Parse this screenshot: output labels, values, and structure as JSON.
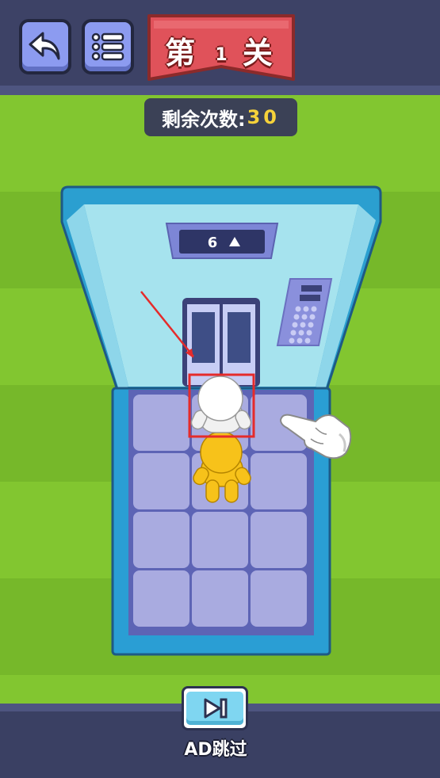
{
  "header": {
    "level_prefix": "第",
    "level_number": "1",
    "level_suffix": "关"
  },
  "moves": {
    "label": "剩余次数:",
    "value": "30"
  },
  "elevator": {
    "floor_display": "6",
    "direction": "up",
    "grid_rows": 4,
    "grid_cols": 3
  },
  "characters": [
    {
      "name": "white",
      "color": "#ffffff",
      "row": 0,
      "col": 1,
      "highlighted": true
    },
    {
      "name": "yellow",
      "color": "#f7c21a",
      "row": 1,
      "col": 1,
      "highlighted": false
    }
  ],
  "footer": {
    "skip_label": "AD跳过"
  },
  "icons": {
    "back": "undo-arrow-icon",
    "menu": "list-menu-icon",
    "skip": "skip-next-icon",
    "hint": "pointing-hand-icon"
  },
  "colors": {
    "highlight": "#e52b2b",
    "banner": "#e0525a",
    "accent_yellow": "#f6d23a"
  }
}
